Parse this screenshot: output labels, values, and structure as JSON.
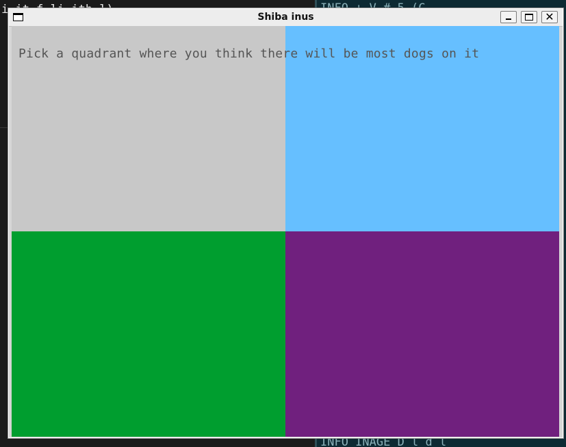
{
  "background": {
    "left_terminal_text": "i   it f        li  ith l)",
    "right_terminal_top_text": "INFO      +  V        #  5 (C",
    "right_terminal_bottom_text": "INFO  INAGE  D   l  d  l"
  },
  "window": {
    "title": "Shiba inus",
    "controls": {
      "minimize_label": "_",
      "maximize_label": "□",
      "close_label": "✕"
    }
  },
  "content": {
    "prompt": "Pick a quadrant where you think there will be most dogs on it",
    "prompt_color": "#555555",
    "quadrants": [
      {
        "name": "top-left",
        "color": "#c8c8c8"
      },
      {
        "name": "top-right",
        "color": "#66bfff"
      },
      {
        "name": "bottom-left",
        "color": "#009e2f"
      },
      {
        "name": "bottom-right",
        "color": "#70207e"
      }
    ]
  }
}
